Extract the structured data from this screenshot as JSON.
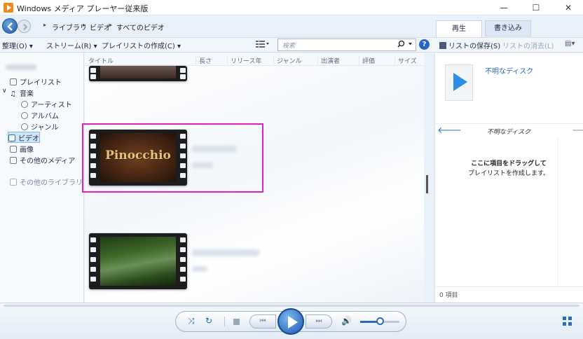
{
  "window": {
    "title": "Windows メディア プレーヤー従来版",
    "minimize": "—",
    "maximize": "☐",
    "close": "✕"
  },
  "breadcrumb": [
    "ライブラリ",
    "ビデオ",
    "すべてのビデオ"
  ],
  "tabs": {
    "play": "再生",
    "burn": "書き込み"
  },
  "toolbar": {
    "organize": "整理(O)",
    "stream": "ストリーム(R)",
    "create_playlist": "プレイリストの作成(C)",
    "search_placeholder": "検索",
    "help": "?"
  },
  "right_toolbar": {
    "save_list": "リストの保存(S)",
    "clear_list": "リストの消去(L)"
  },
  "sidebar": {
    "items": [
      {
        "label": "プレイリスト",
        "icon": "playlist-icon"
      },
      {
        "label": "音楽",
        "icon": "music-note-icon"
      },
      {
        "label": "アーティスト",
        "icon": "artist-icon"
      },
      {
        "label": "アルバム",
        "icon": "album-icon"
      },
      {
        "label": "ジャンル",
        "icon": "genre-icon"
      },
      {
        "label": "ビデオ",
        "icon": "video-icon",
        "selected": true
      },
      {
        "label": "画像",
        "icon": "picture-icon"
      },
      {
        "label": "その他のメディア",
        "icon": "other-media-icon"
      },
      {
        "label": "その他のライブラリ",
        "icon": "other-library-icon"
      }
    ]
  },
  "columns": [
    "タイトル",
    "長さ",
    "リリース年",
    "ジャンル",
    "出演者",
    "評価",
    "サイズ"
  ],
  "videos": [
    {
      "thumb_text": ""
    },
    {
      "thumb_text": "Pinocchio",
      "selected": true
    },
    {
      "thumb_text": ""
    }
  ],
  "right_pane": {
    "disc_link": "不明なディスク",
    "disc_title": "不明なディスク",
    "drop_hint_title": "ここに項目をドラッグして",
    "drop_hint_sub": "プレイリストを作成します。",
    "item_count": "0 項目"
  },
  "player": {
    "volume_percent": 50,
    "shuffle_icon": "shuffle-icon",
    "repeat_icon": "repeat-icon"
  },
  "colors": {
    "accent": "#2a6ac0",
    "selection_border": "#e022c4",
    "play_button": "#1a58b0"
  }
}
